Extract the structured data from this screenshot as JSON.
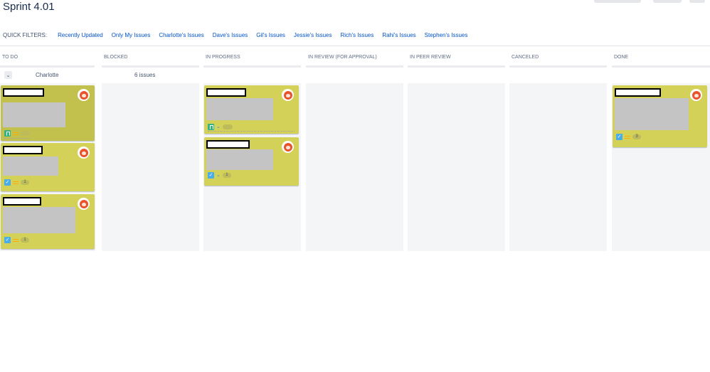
{
  "page": {
    "title": "Sprint 4.01"
  },
  "quick_filters": {
    "label": "QUICK FILTERS:",
    "items": [
      "Recently Updated",
      "Only My Issues",
      "Charlotte's Issues",
      "Dave's Issues",
      "Gil's Issues",
      "Jessie's Issues",
      "Rich's Issues",
      "Rahi's Issues",
      "Stephen's Issues"
    ]
  },
  "columns": [
    {
      "name": "TO DO"
    },
    {
      "name": "BLOCKED"
    },
    {
      "name": "IN PROGRESS"
    },
    {
      "name": "IN REVIEW (FOR APPROVAL)"
    },
    {
      "name": "IN PEER REVIEW"
    },
    {
      "name": "CANCELED"
    },
    {
      "name": "DONE"
    }
  ],
  "swimlane": {
    "toggle_icon": "chevron-down-icon",
    "owner": "Charlotte",
    "count": "6 issues"
  },
  "cards": [
    {
      "column": "TO DO",
      "type": "story",
      "priority": "medium",
      "estimate": ""
    },
    {
      "column": "TO DO",
      "type": "task",
      "priority": "medium",
      "estimate": "1"
    },
    {
      "column": "TO DO",
      "type": "task",
      "priority": "medium",
      "estimate": "1"
    },
    {
      "column": "IN PROGRESS",
      "type": "story",
      "priority": "low",
      "estimate": ""
    },
    {
      "column": "IN PROGRESS",
      "type": "task",
      "priority": "low",
      "estimate": "1"
    },
    {
      "column": "DONE",
      "type": "task",
      "priority": "medium",
      "estimate": "3"
    }
  ],
  "colors": {
    "card": "#d3d158",
    "card_highlight": "#c3c14e",
    "link": "#0052cc",
    "column_bg": "#f4f5f7"
  }
}
